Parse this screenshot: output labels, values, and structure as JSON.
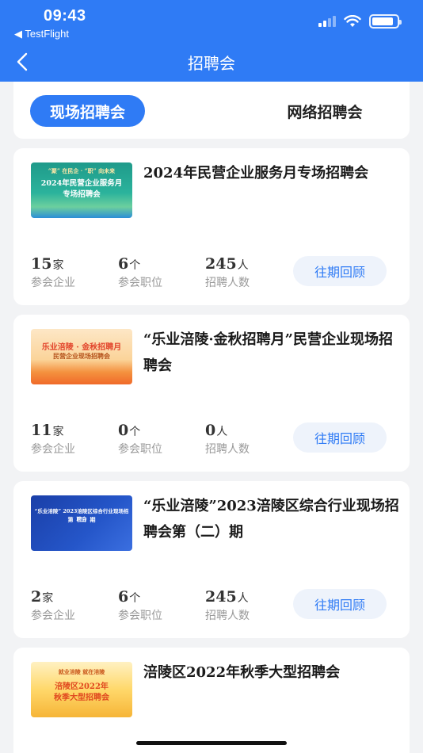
{
  "status": {
    "time": "09:43",
    "back_app": "◀ TestFlight"
  },
  "nav": {
    "title": "招聘会"
  },
  "tabs": {
    "onsite": "现场招聘会",
    "online": "网络招聘会"
  },
  "cards": [
    {
      "title": "2024年民营企业服务月专场招聘会",
      "thumb": {
        "line1": "“聚” 在民企 · “职” 向未来",
        "line2": "2024年民营企业服务月",
        "line3": "专场招聘会"
      },
      "stats": [
        {
          "num": "15",
          "unit": "家",
          "label": "参会企业"
        },
        {
          "num": "6",
          "unit": "个",
          "label": "参会职位"
        },
        {
          "num": "245",
          "unit": "人",
          "label": "招聘人数"
        }
      ],
      "button": "往期回顾"
    },
    {
      "title": "“乐业涪陵·金秋招聘月”民营企业现场招聘会",
      "thumb": {
        "line1": "乐业涪陵 · 金秋招聘月",
        "line2": "民营企业现场招聘会",
        "line3": ""
      },
      "stats": [
        {
          "num": "11",
          "unit": "家",
          "label": "参会企业"
        },
        {
          "num": "0",
          "unit": "个",
          "label": "参会职位"
        },
        {
          "num": "0",
          "unit": "人",
          "label": "招聘人数"
        }
      ],
      "button": "往期回顾"
    },
    {
      "title": "“乐业涪陵”2023涪陵区综合行业现场招聘会第（二）期",
      "thumb": {
        "line1": "“乐业涪陵” 2023涪陵区综合行业现场招聘会",
        "line2": "第（二）期",
        "line3": ""
      },
      "stats": [
        {
          "num": "2",
          "unit": "家",
          "label": "参会企业"
        },
        {
          "num": "6",
          "unit": "个",
          "label": "参会职位"
        },
        {
          "num": "245",
          "unit": "人",
          "label": "招聘人数"
        }
      ],
      "button": "往期回顾"
    },
    {
      "title": "涪陵区2022年秋季大型招聘会",
      "thumb": {
        "line1": "就业涪陵  就在涪陵",
        "line2": "涪陵区2022年",
        "line3": "秋季大型招聘会"
      }
    }
  ],
  "colors": {
    "primary": "#2f7bf5",
    "button_bg": "#eef3fb",
    "page_bg": "#f2f3f5"
  }
}
